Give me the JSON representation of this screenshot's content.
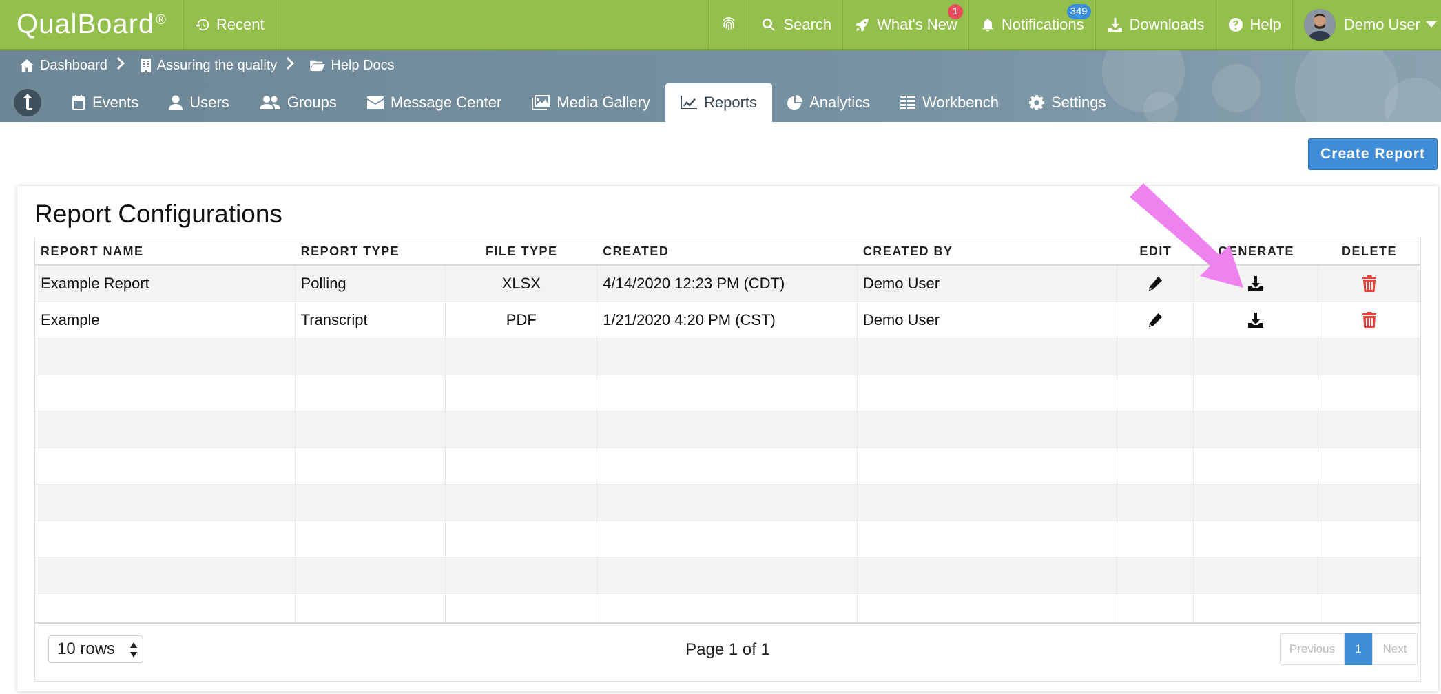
{
  "topbar": {
    "brand": "QualBoard",
    "brand_mark": "®",
    "recent": "Recent",
    "search": "Search",
    "whats_new": "What's New",
    "whats_new_badge": "1",
    "notifications": "Notifications",
    "notifications_badge": "349",
    "downloads": "Downloads",
    "help": "Help",
    "user": "Demo User"
  },
  "breadcrumb": [
    "Dashboard",
    "Assuring the quality",
    "Help Docs"
  ],
  "tabs": [
    "Events",
    "Users",
    "Groups",
    "Message Center",
    "Media Gallery",
    "Reports",
    "Analytics",
    "Workbench",
    "Settings"
  ],
  "active_tab": "Reports",
  "create_button": "Create Report",
  "card_title": "Report Configurations",
  "columns": [
    "REPORT NAME",
    "REPORT TYPE",
    "FILE TYPE",
    "CREATED",
    "CREATED BY",
    "EDIT",
    "GENERATE",
    "DELETE"
  ],
  "rows": [
    {
      "name": "Example Report",
      "type": "Polling",
      "file_type": "XLSX",
      "created": "4/14/2020 12:23 PM (CDT)",
      "created_by": "Demo User"
    },
    {
      "name": "Example",
      "type": "Transcript",
      "file_type": "PDF",
      "created": "1/21/2020 4:20 PM (CST)",
      "created_by": "Demo User"
    }
  ],
  "pagination": {
    "rows_select": "10 rows",
    "page_info": "Page 1 of 1",
    "previous": "Previous",
    "current": "1",
    "next": "Next"
  },
  "colors": {
    "topbar": "#93bf4c",
    "accent": "#3f8dd8",
    "delete": "#e8413c",
    "annotation_arrow": "#ee82ee"
  }
}
